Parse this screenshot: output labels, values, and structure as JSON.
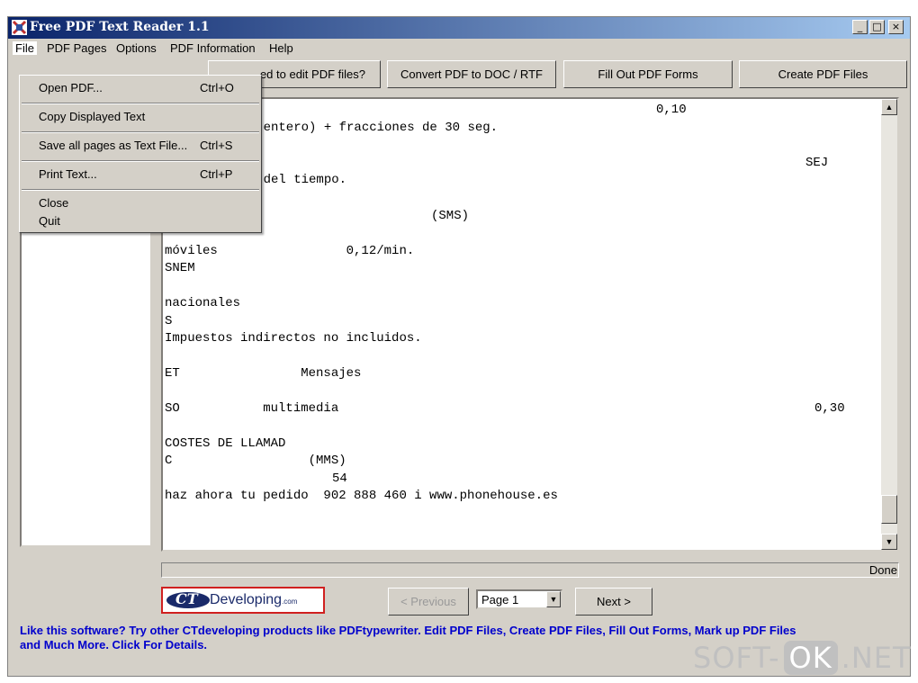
{
  "window": {
    "title": "Free PDF Text Reader 1.1",
    "controls": {
      "minimize": "_",
      "maximize": "□",
      "close": "×"
    }
  },
  "menubar": {
    "items": [
      "File",
      "PDF Pages",
      "Options",
      "PDF Information",
      "Help"
    ]
  },
  "toolbar": {
    "buttons": [
      "Need to edit PDF files?",
      "Convert PDF to DOC / RTF",
      "Fill Out PDF Forms",
      "Create PDF Files"
    ],
    "visible_first": "ed to edit PDF files?"
  },
  "file_menu": {
    "items": [
      {
        "label": "Open PDF...",
        "shortcut": "Ctrl+O"
      },
      {
        "label": "Copy Displayed Text",
        "shortcut": ""
      },
      {
        "label": "Save all pages as Text File...",
        "shortcut": "Ctrl+S"
      },
      {
        "label": "Print Text...",
        "shortcut": "Ctrl+P"
      },
      {
        "label": "Close",
        "shortcut": ""
      },
      {
        "label": "Quit",
        "shortcut": ""
      }
    ]
  },
  "document_text": {
    "lines": [
      "0,10",
      "to (entero) + fracciones de 30 seg.",
      "SEJ",
      "sto del tiempo.",
      "(SMS)",
      "móviles                 0,12/min.",
      "SNEM",
      "nacionales",
      "S",
      "Impuestos indirectos no incluidos.",
      "ET                Mensajes",
      "SO           multimedia",
      "0,30",
      "COSTES DE LLAMAD",
      "C                  (MMS)",
      "54",
      "haz ahora tu pedido  902 888 460 i www.phonehouse.es"
    ]
  },
  "status": {
    "text": "Done"
  },
  "navigation": {
    "prev_label": "< Previous",
    "next_label": "Next >",
    "page_selected": "Page 1"
  },
  "logo": {
    "ct": "CT",
    "text": "Developing",
    "suffix": ".com"
  },
  "promo": {
    "line1": "Like this software? Try other CTdeveloping products like PDFtypewriter.  Edit PDF Files, Create PDF Files, Fill Out Forms, Mark up PDF Files",
    "line2": "and Much More.  Click For Details."
  },
  "watermark": {
    "left": "SOFT-",
    "mid": "OK",
    "right": ".NET"
  },
  "colors": {
    "titlebar_start": "#0a246a",
    "titlebar_end": "#a6caf0",
    "promo_text": "#0000cc",
    "logo_border": "#d02020"
  }
}
